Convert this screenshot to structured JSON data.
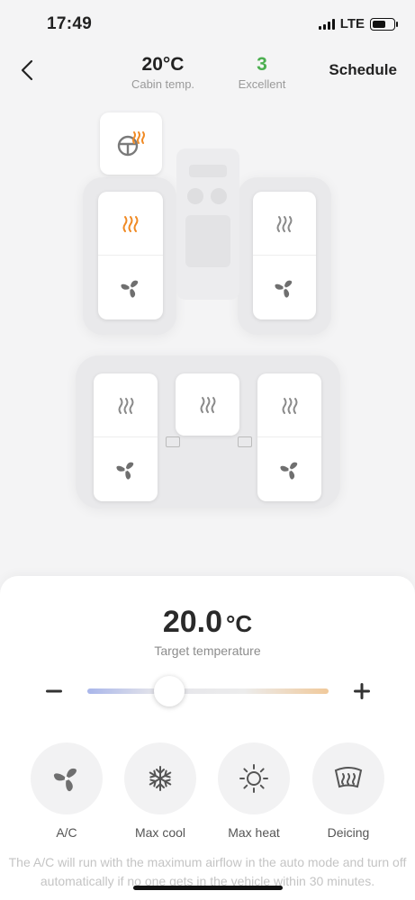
{
  "status_bar": {
    "time": "17:49",
    "network": "LTE"
  },
  "header": {
    "cabin_temp_value": "20°C",
    "cabin_temp_label": "Cabin temp.",
    "air_quality_value": "3",
    "air_quality_label": "Excellent",
    "air_quality_color": "#4caf50",
    "schedule_label": "Schedule"
  },
  "colors": {
    "heat_active": "#f08a24",
    "icon_inactive": "#8a8a8a"
  },
  "seats": {
    "steering_wheel_heat": {
      "active": true
    },
    "driver": {
      "heat_active": true,
      "ventilation_active": false
    },
    "front_passenger": {
      "heat_active": false,
      "ventilation_active": false
    },
    "rear_left": {
      "heat_active": false,
      "ventilation_active": false
    },
    "rear_center": {
      "heat_active": false
    },
    "rear_right": {
      "heat_active": false,
      "ventilation_active": false
    }
  },
  "controls": {
    "target_temp_value": "20.0",
    "target_temp_unit": "°C",
    "target_temp_label": "Target temperature",
    "slider_fraction": 0.34
  },
  "modes": [
    {
      "label": "A/C",
      "icon": "fan-icon"
    },
    {
      "label": "Max cool",
      "icon": "snowflake-icon"
    },
    {
      "label": "Max heat",
      "icon": "sun-icon"
    },
    {
      "label": "Deicing",
      "icon": "windshield-defrost-icon"
    }
  ],
  "info_text": "The A/C will run with the maximum airflow in the auto mode and turn off automatically if no one gets in the vehicle within 30 minutes."
}
